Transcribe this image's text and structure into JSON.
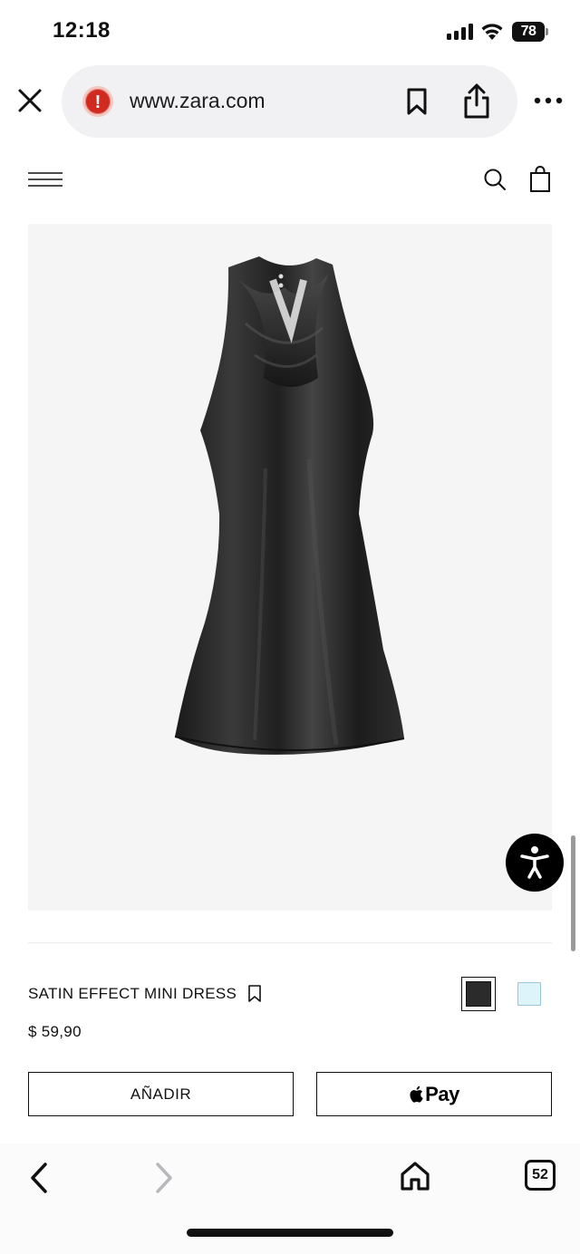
{
  "status_bar": {
    "time": "12:18",
    "battery": "78",
    "icons": [
      "signal-icon",
      "wifi-icon",
      "battery-icon"
    ]
  },
  "browser": {
    "url": "www.zara.com",
    "security_icon": "alert-icon",
    "security_symbol": "!",
    "buttons": [
      "close-icon",
      "bookmark-icon",
      "share-icon",
      "more-icon"
    ]
  },
  "site_header": {
    "icons": [
      "menu-icon",
      "search-icon",
      "shopping-bag-icon"
    ]
  },
  "product": {
    "name": "SATIN EFFECT MINI DRESS",
    "price": "$ 59,90",
    "image": "black satin halter dress",
    "colors": [
      {
        "name": "black",
        "hex": "#2b2b2b",
        "selected": true
      },
      {
        "name": "light blue",
        "hex": "#def4fb",
        "selected": false
      }
    ]
  },
  "actions": {
    "add_label": "AÑADIR",
    "applepay_label": "Pay"
  },
  "toolbar": {
    "tabs_count": "52",
    "icons": [
      "back-icon",
      "forward-icon",
      "home-icon",
      "tabs-icon"
    ]
  },
  "colors": {
    "alert": "#d12a20",
    "image_background": "#f5f5f5",
    "accessibility_button": "#000000"
  }
}
